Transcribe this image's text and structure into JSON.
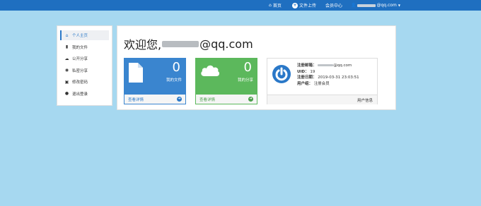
{
  "navbar": {
    "home_label": "首页",
    "upload_label": "文件上传",
    "member_label": "会员中心",
    "user_label": "@qq.com"
  },
  "sidebar": {
    "items": [
      {
        "label": "个人主页",
        "icon": "home-icon",
        "active": true
      },
      {
        "label": "我的文件",
        "icon": "file-icon"
      },
      {
        "label": "公开分享",
        "icon": "cloud-icon"
      },
      {
        "label": "私密分享",
        "icon": "eye-slash-icon"
      },
      {
        "label": "修改密码",
        "icon": "lock-icon"
      },
      {
        "label": "退出登录",
        "icon": "power-icon"
      }
    ]
  },
  "main": {
    "welcome_prefix": "欢迎您,",
    "welcome_suffix": "@qq.com",
    "files_card": {
      "count": "0",
      "label": "我的文件",
      "link": "查看详情"
    },
    "shares_card": {
      "count": "0",
      "label": "我的分享",
      "link": "查看详情"
    },
    "profile": {
      "email_label": "注册邮箱：",
      "email_value": "@qq.com",
      "uid_label": "UID：",
      "uid_value": "19",
      "date_label": "注册日期：",
      "date_value": "2019-03-31 23:03:51",
      "group_label": "用户组：",
      "group_value": "注册会员",
      "footer": "用户信息"
    }
  },
  "colors": {
    "navbar": "#1f6fc0",
    "background": "#a6d8f0",
    "files_card": "#3a85cf",
    "shares_card": "#5cb85c"
  }
}
